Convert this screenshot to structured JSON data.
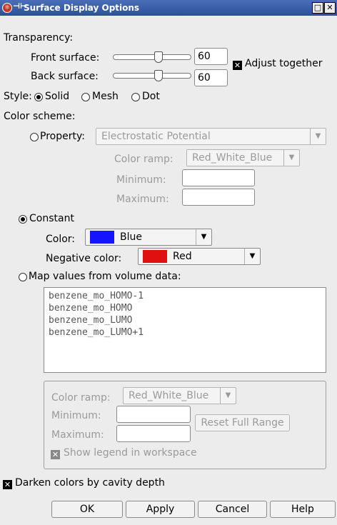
{
  "window": {
    "title": "Surface Display Options"
  },
  "transparency": {
    "label": "Transparency:",
    "front_label": "Front surface:",
    "front_value": "60",
    "back_label": "Back surface:",
    "back_value": "60",
    "adjust_together": "Adjust together"
  },
  "style": {
    "label": "Style:",
    "options": [
      "Solid",
      "Mesh",
      "Dot"
    ],
    "selected": "Solid"
  },
  "color_scheme": {
    "label": "Color scheme:",
    "property": {
      "label": "Property:",
      "value": "Electrostatic Potential",
      "ramp_label": "Color ramp:",
      "ramp_value": "Red_White_Blue",
      "min_label": "Minimum:",
      "max_label": "Maximum:"
    },
    "constant": {
      "label": "Constant",
      "color_label": "Color:",
      "color_value": "Blue",
      "color_hex": "#1414ff",
      "neg_label": "Negative color:",
      "neg_value": "Red",
      "neg_hex": "#e01010"
    },
    "map": {
      "label": "Map values from volume data:",
      "items": [
        "benzene_mo_HOMO-1",
        "benzene_mo_HOMO",
        "benzene_mo_LUMO",
        "benzene_mo_LUMO+1"
      ],
      "ramp_label": "Color ramp:",
      "ramp_value": "Red_White_Blue",
      "min_label": "Minimum:",
      "max_label": "Maximum:",
      "reset_button": "Reset Full Range",
      "show_legend": "Show legend in workspace"
    }
  },
  "darken": "Darken colors by cavity depth",
  "buttons": {
    "ok": "OK",
    "apply": "Apply",
    "cancel": "Cancel",
    "help": "Help"
  }
}
